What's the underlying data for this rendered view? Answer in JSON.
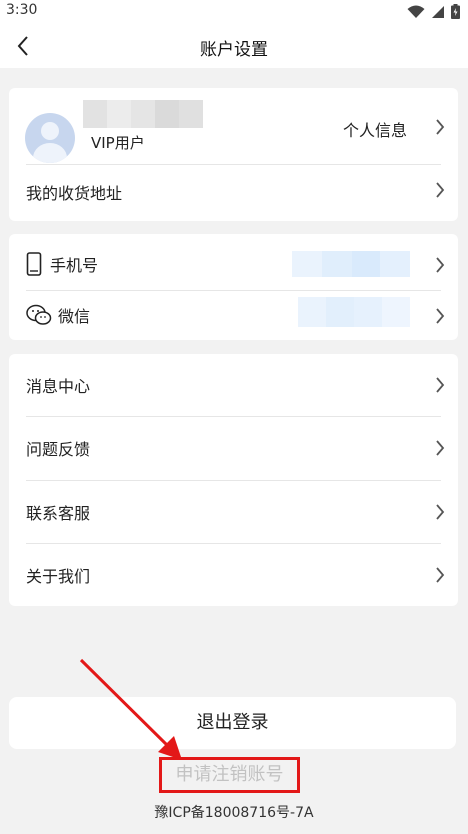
{
  "status_bar": {
    "time": "3:30",
    "icons": [
      "wifi-icon",
      "signal-icon",
      "battery-icon"
    ]
  },
  "header": {
    "title": "账户设置",
    "back_icon": "chevron-left-icon"
  },
  "profile_card": {
    "member_label": "VIP用户",
    "personal_info_label": "个人信息",
    "address_label": "我的收货地址"
  },
  "account_card": {
    "phone_label": "手机号",
    "wechat_label": "微信"
  },
  "menu_card": {
    "items": [
      {
        "label": "消息中心"
      },
      {
        "label": "问题反馈"
      },
      {
        "label": "联系客服"
      },
      {
        "label": "关于我们"
      }
    ]
  },
  "logout_label": "退出登录",
  "cancel_account_label": "申请注销账号",
  "icp_text": "豫ICP备18008716号-7A",
  "colors": {
    "annotation_red": "#e31818",
    "background": "#f2f2f2",
    "card": "#ffffff"
  }
}
